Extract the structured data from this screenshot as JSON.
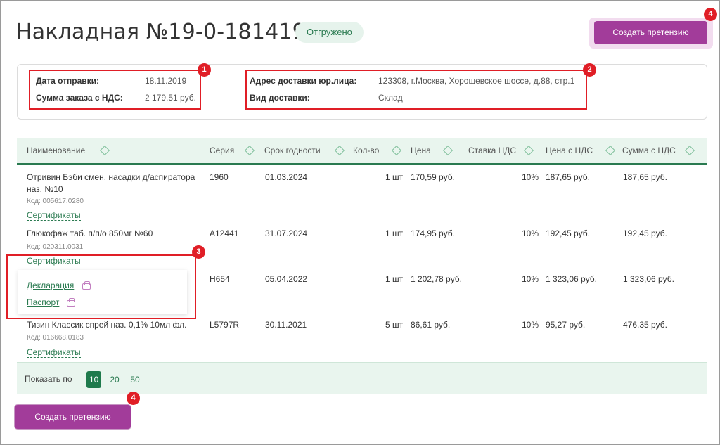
{
  "header": {
    "title": "Накладная №19-0-1814190",
    "status": "Отгружено",
    "claim_button": "Создать претензию"
  },
  "info": {
    "ship_date_label": "Дата отправки:",
    "ship_date": "18.11.2019",
    "total_label": "Сумма заказа с НДС:",
    "total": "2 179,51 руб.",
    "address_label": "Адрес доставки юр.лица:",
    "address": "123308, г.Москва, Хорошевское шоссе, д.88, стр.1",
    "delivery_label": "Вид доставки:",
    "delivery": "Склад"
  },
  "table": {
    "columns": [
      "Наименование",
      "Серия",
      "Срок годности",
      "Кол-во",
      "Цена",
      "Ставка НДС",
      "Цена с НДС",
      "Сумма с НДС"
    ],
    "rows": [
      {
        "name1": "Отривин Бэби смен. насадки д/аспиратора",
        "name2": "наз. №10",
        "code": "Код: 005617.0280",
        "series": "1960",
        "expiry": "01.03.2024",
        "qty": "1 шт",
        "price": "170,59 руб.",
        "vat": "10%",
        "price_vat": "187,65 руб.",
        "sum_vat": "187,65 руб.",
        "certs": "Сертификаты"
      },
      {
        "name1": "Глюкофаж таб. п/п/о 850мг №60",
        "code": "Код: 020311.0031",
        "series": "A12441",
        "expiry": "31.07.2024",
        "qty": "1 шт",
        "price": "174,95 руб.",
        "vat": "10%",
        "price_vat": "192,45 руб.",
        "sum_vat": "192,45 руб.",
        "certs": "Сертификаты"
      },
      {
        "series": "H654",
        "expiry": "05.04.2022",
        "qty": "1 шт",
        "price": "1 202,78 руб.",
        "vat": "10%",
        "price_vat": "1 323,06 руб.",
        "sum_vat": "1 323,06 руб."
      },
      {
        "name1": "Тизин Классик спрей наз. 0,1% 10мл фл.",
        "code": "Код: 016668.0183",
        "series": "L5797R",
        "expiry": "30.11.2021",
        "qty": "5 шт",
        "price": "86,61 руб.",
        "vat": "10%",
        "price_vat": "95,27 руб.",
        "sum_vat": "476,35 руб.",
        "certs": "Сертификаты"
      }
    ]
  },
  "cert_popup": {
    "declaration": "Декларация",
    "passport": "Паспорт"
  },
  "pager": {
    "label": "Показать по",
    "options": [
      "10",
      "20",
      "50"
    ]
  },
  "badges": [
    "1",
    "2",
    "3",
    "4"
  ],
  "colors": {
    "accent": "#a23c9a",
    "green": "#2a7a50",
    "marker": "#e01e26"
  }
}
